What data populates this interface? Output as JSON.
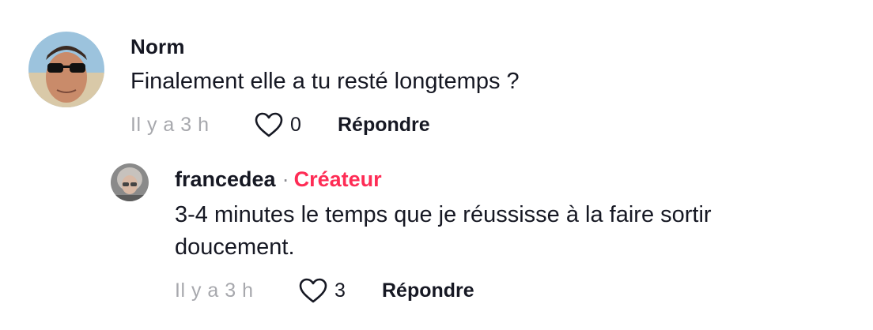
{
  "comment": {
    "author": "Norm",
    "text": "Finalement elle a tu resté longtemps ?",
    "time": "Il y a 3 h",
    "likes": "0",
    "reply_label": "Répondre",
    "like_icon": "heart-outline-icon"
  },
  "reply": {
    "author": "francedea",
    "separator": "·",
    "badge": "Créateur",
    "text_line1": "3-4 minutes le temps que je réussisse à la faire sortir",
    "text_line2": "doucement.",
    "time": "Il y a 3 h",
    "likes": "3",
    "reply_label": "Répondre",
    "like_icon": "heart-outline-icon"
  },
  "colors": {
    "creator_badge": "#fe2c55",
    "muted_text": "#a7a8ad",
    "primary_text": "#161823"
  }
}
